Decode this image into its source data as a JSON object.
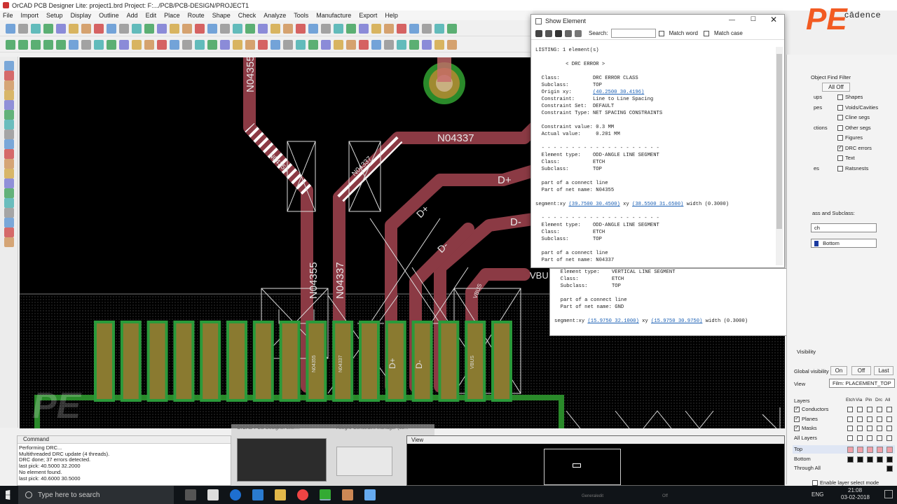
{
  "window": {
    "title": "OrCAD PCB Designer Lite: project1.brd  Project: F:.../PCB/PCB-DESIGN/PROJECT1"
  },
  "menu": [
    "File",
    "Import",
    "Setup",
    "Display",
    "Outline",
    "Add",
    "Edit",
    "Place",
    "Route",
    "Shape",
    "Check",
    "Analyze",
    "Tools",
    "Manufacture",
    "Export",
    "Help"
  ],
  "brand": {
    "logo": "PE",
    "company": "cādence",
    "accent": "#f25b22"
  },
  "nets": {
    "n04355_top": "N04355",
    "n04337_right": "N04337",
    "diag_a": "N04355",
    "diag_b": "N04337",
    "dplus_1": "D+",
    "dminus_1": "D-",
    "dplus_2": "D+",
    "dminus_2": "D-",
    "vert_1": "N04355",
    "vert_2": "N04337",
    "vbus": "VBUS",
    "vbu": "VBU",
    "pad_1": "N04355",
    "pad_2": "N04337",
    "pad_3": "D+",
    "pad_4": "D-",
    "pad_5": "VBUS"
  },
  "show_element": {
    "title": "Show Element",
    "search_label": "Search:",
    "search_value": "",
    "match_word": "Match word",
    "match_case": "Match case",
    "lines": [
      {
        "t": "LISTING: 1 element(s)"
      },
      {
        "t": ""
      },
      {
        "t": "          < DRC ERROR >"
      },
      {
        "t": ""
      },
      {
        "t": "  Class:           DRC ERROR CLASS"
      },
      {
        "t": "  Subclass:        TOP"
      },
      {
        "t": "  Origin xy:       ",
        "link": "(40.2500 30.4196)"
      },
      {
        "t": "  Constraint:      Line to Line Spacing"
      },
      {
        "t": "  Constraint Set:  DEFAULT"
      },
      {
        "t": "  Constraint Type: NET SPACING CONSTRAINTS"
      },
      {
        "t": ""
      },
      {
        "t": "  Constraint value: 0.3 MM"
      },
      {
        "t": "  Actual value:     0.201 MM"
      },
      {
        "t": ""
      },
      {
        "t": "  - - - - - - - - - - - - - - - - - - - -"
      },
      {
        "t": "  Element type:    ODD-ANGLE LINE SEGMENT"
      },
      {
        "t": "  Class:           ETCH"
      },
      {
        "t": "  Subclass:        TOP"
      },
      {
        "t": ""
      },
      {
        "t": "  part of a connect line"
      },
      {
        "t": "  Part of net name: N04355"
      },
      {
        "t": ""
      },
      {
        "t": "segment:xy ",
        "link": "(39.7500 30.4500)",
        "t2": " xy ",
        "link2": "(38.5500 31.6500)",
        "t3": " width (0.3000)"
      },
      {
        "t": ""
      },
      {
        "t": "  - - - - - - - - - - - - - - - - - - - -"
      },
      {
        "t": "  Element type:    ODD-ANGLE LINE SEGMENT"
      },
      {
        "t": "  Class:           ETCH"
      },
      {
        "t": "  Subclass:        TOP"
      },
      {
        "t": ""
      },
      {
        "t": "  part of a connect line"
      },
      {
        "t": "  Part of net name: N04337"
      }
    ]
  },
  "bg_listing": {
    "lines": [
      {
        "t": "  Element type:    VERTICAL LINE SEGMENT"
      },
      {
        "t": "  Class:           ETCH"
      },
      {
        "t": "  Subclass:        TOP"
      },
      {
        "t": ""
      },
      {
        "t": "  part of a connect line"
      },
      {
        "t": "  Part of net name: GND"
      },
      {
        "t": ""
      },
      {
        "t": "segment:xy ",
        "link": "(15.9750 32.1000)",
        "t2": " xy ",
        "link2": "(15.9750 30.9750)",
        "t3": " width (0.3000)"
      }
    ]
  },
  "find_filter": {
    "title": "Object Find Filter",
    "all_off": "All Off",
    "items": [
      {
        "label": "Shapes",
        "checked": false
      },
      {
        "label": "Voids/Cavities",
        "checked": false
      },
      {
        "label": "Cline segs",
        "checked": false
      },
      {
        "label": "Other segs",
        "checked": false
      },
      {
        "label": "Figures",
        "checked": false
      },
      {
        "label": "DRC errors",
        "checked": true
      },
      {
        "label": "Text",
        "checked": false
      },
      {
        "label": "Ratsnests",
        "checked": false
      }
    ],
    "left_cut": [
      "ups",
      "pes",
      "",
      "ctions",
      "",
      "",
      "",
      "es"
    ]
  },
  "options": {
    "class_label": "ass and Subclass:",
    "class_value": "ch",
    "subclass_value": "Bottom"
  },
  "visibility": {
    "title": "Visibility",
    "global_label": "Global visibility",
    "on": "On",
    "off": "Off",
    "last": "Last",
    "view_label": "View",
    "view_value": "Film: PLACEMENT_TOP",
    "layers_label": "Layers",
    "col_headers": [
      "Etch",
      "Via",
      "Pin",
      "Drc",
      "All"
    ],
    "layers": [
      {
        "label": "Conductors",
        "checked": true
      },
      {
        "label": "Planes",
        "checked": true
      },
      {
        "label": "Masks",
        "checked": true
      },
      {
        "label": "All Layers",
        "checked": false
      }
    ],
    "rows": [
      {
        "label": "Top",
        "color": "#f0a0a8"
      },
      {
        "label": "Bottom",
        "color": "#111111"
      },
      {
        "label": "Through All",
        "color": "#111111"
      }
    ],
    "enable_layer": "Enable layer select mode"
  },
  "command": {
    "title": "Command",
    "lines": [
      "Performing DRC...",
      "Multithreaded DRC update (4 threads).",
      "DRC done; 37 errors detected.",
      "last pick:  40.5000 32.2000",
      "No element found.",
      "last pick:  40.6000 30.5000"
    ]
  },
  "view": {
    "title": "View"
  },
  "taskbar": {
    "search_placeholder": "Type here to search",
    "lang": "ENG",
    "time": "21:08",
    "date": "03-02-2018",
    "thumb1": "OrCAD PCB Designer Lite:...",
    "thumb2": "Allegro Constraint Manager (co..."
  },
  "status": {
    "mode": "Generaledit",
    "state": "Off"
  }
}
